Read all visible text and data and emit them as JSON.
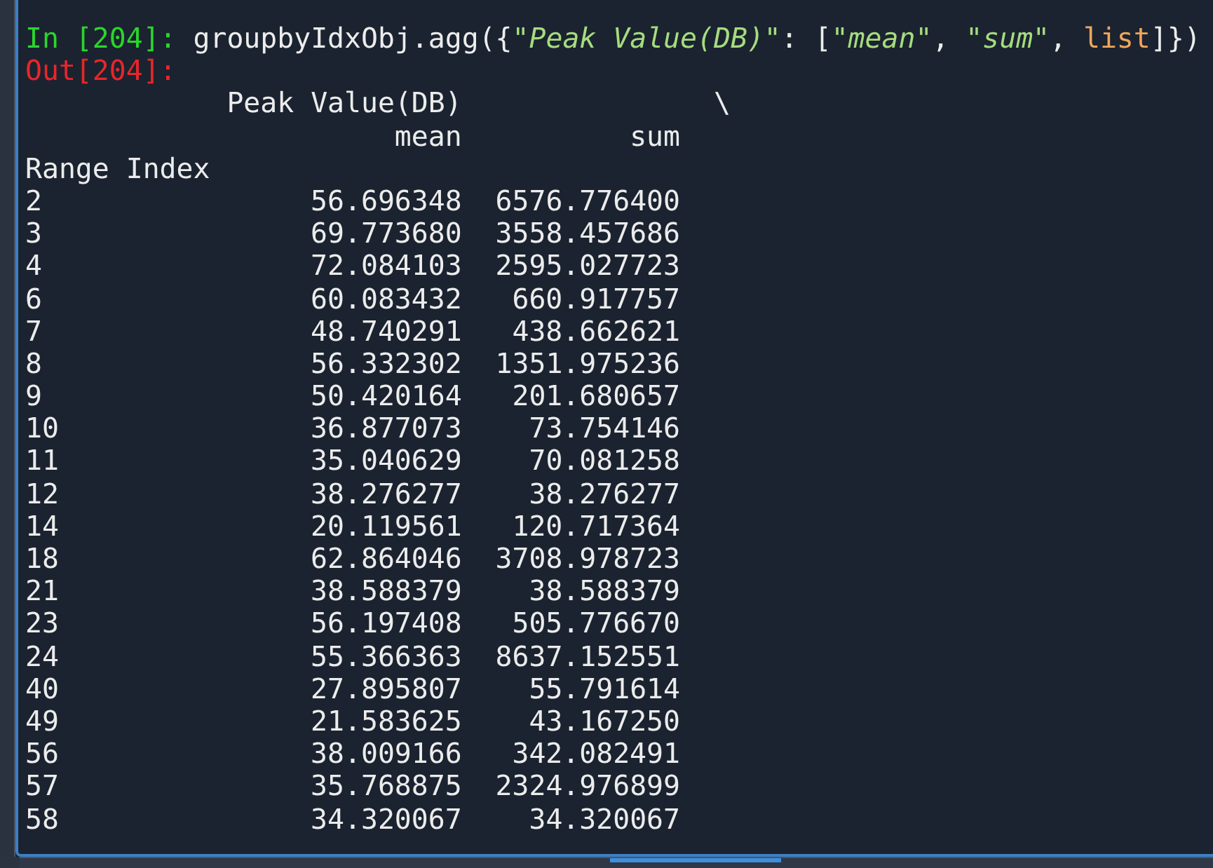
{
  "input": {
    "prompt": "In [204]:",
    "code": [
      {
        "kind": "plain",
        "text": "groupbyIdxObj.agg({"
      },
      {
        "kind": "string",
        "text": "\"Peak Value(DB)\""
      },
      {
        "kind": "plain",
        "text": ": ["
      },
      {
        "kind": "string",
        "text": "\"mean\""
      },
      {
        "kind": "plain",
        "text": ", "
      },
      {
        "kind": "string",
        "text": "\"sum\""
      },
      {
        "kind": "plain",
        "text": ", "
      },
      {
        "kind": "builtin",
        "text": "list"
      },
      {
        "kind": "plain",
        "text": "]})"
      }
    ]
  },
  "output": {
    "prompt": "Out[204]:",
    "column_group": "Peak Value(DB)",
    "continuation": "\\",
    "columns": [
      "mean",
      "sum"
    ],
    "index_name": "Range Index",
    "rows": [
      {
        "index": "2",
        "mean": "56.696348",
        "sum": "6576.776400"
      },
      {
        "index": "3",
        "mean": "69.773680",
        "sum": "3558.457686"
      },
      {
        "index": "4",
        "mean": "72.084103",
        "sum": "2595.027723"
      },
      {
        "index": "6",
        "mean": "60.083432",
        "sum": "660.917757"
      },
      {
        "index": "7",
        "mean": "48.740291",
        "sum": "438.662621"
      },
      {
        "index": "8",
        "mean": "56.332302",
        "sum": "1351.975236"
      },
      {
        "index": "9",
        "mean": "50.420164",
        "sum": "201.680657"
      },
      {
        "index": "10",
        "mean": "36.877073",
        "sum": "73.754146"
      },
      {
        "index": "11",
        "mean": "35.040629",
        "sum": "70.081258"
      },
      {
        "index": "12",
        "mean": "38.276277",
        "sum": "38.276277"
      },
      {
        "index": "14",
        "mean": "20.119561",
        "sum": "120.717364"
      },
      {
        "index": "18",
        "mean": "62.864046",
        "sum": "3708.978723"
      },
      {
        "index": "21",
        "mean": "38.588379",
        "sum": "38.588379"
      },
      {
        "index": "23",
        "mean": "56.197408",
        "sum": "505.776670"
      },
      {
        "index": "24",
        "mean": "55.366363",
        "sum": "8637.152551"
      },
      {
        "index": "40",
        "mean": "27.895807",
        "sum": "55.791614"
      },
      {
        "index": "49",
        "mean": "21.583625",
        "sum": "43.167250"
      },
      {
        "index": "56",
        "mean": "38.009166",
        "sum": "342.082491"
      },
      {
        "index": "57",
        "mean": "35.768875",
        "sum": "2324.976899"
      },
      {
        "index": "58",
        "mean": "34.320067",
        "sum": "34.320067"
      }
    ]
  }
}
